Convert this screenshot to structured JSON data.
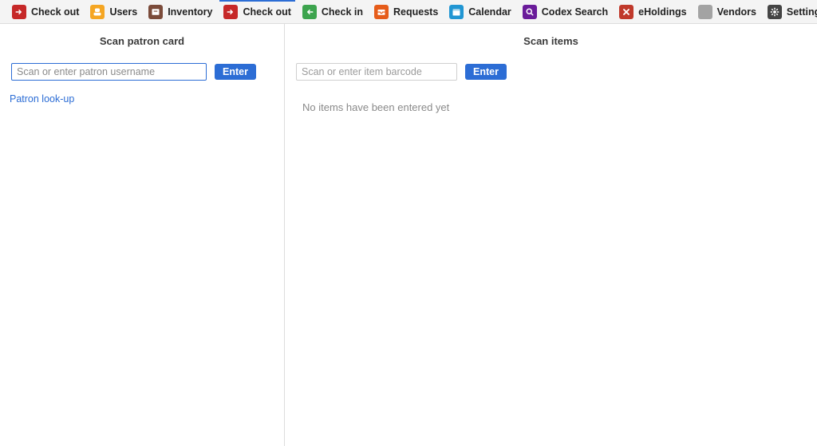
{
  "currentApp": {
    "label": "Check out"
  },
  "nav": {
    "items": [
      {
        "label": "Users",
        "color": "amber",
        "icon": "user"
      },
      {
        "label": "Inventory",
        "color": "brown",
        "icon": "drawer"
      },
      {
        "label": "Check out",
        "color": "red",
        "icon": "arrow-right",
        "active": true
      },
      {
        "label": "Check in",
        "color": "green",
        "icon": "arrow-left"
      },
      {
        "label": "Requests",
        "color": "orange",
        "icon": "inbox"
      },
      {
        "label": "Calendar",
        "color": "blue",
        "icon": "calendar"
      },
      {
        "label": "Codex Search",
        "color": "purple",
        "icon": "search"
      },
      {
        "label": "eHoldings",
        "color": "redx",
        "icon": "cross"
      },
      {
        "label": "Vendors",
        "color": "gray",
        "icon": "blank"
      },
      {
        "label": "Settings",
        "color": "dark",
        "icon": "gear"
      }
    ]
  },
  "patronPane": {
    "title": "Scan patron card",
    "input": {
      "placeholder": "Scan or enter patron username",
      "value": ""
    },
    "enterLabel": "Enter",
    "lookupLink": "Patron look-up"
  },
  "itemsPane": {
    "title": "Scan items",
    "input": {
      "placeholder": "Scan or enter item barcode",
      "value": ""
    },
    "enterLabel": "Enter",
    "emptyMessage": "No items have been entered yet"
  },
  "icons": {
    "user": "<rect x='4' y='2' width='8' height='6' rx='2' fill='white'/><rect x='2' y='9' width='12' height='5' rx='2' fill='white'/>",
    "drawer": "<rect x='2' y='3' width='12' height='10' rx='1' fill='white'/><rect x='5' y='6' width='6' height='1.5' fill='#7b4b3a'/>",
    "arrow-right": "<path d='M3 8h7M8 5l3 3-3 3' stroke='white' stroke-width='2' fill='none' stroke-linecap='round' stroke-linejoin='round'/>",
    "arrow-left": "<path d='M13 8H6M8 5L5 8l3 3' stroke='white' stroke-width='2' fill='none' stroke-linecap='round' stroke-linejoin='round'/>",
    "inbox": "<rect x='2' y='4' width='12' height='9' rx='1' fill='white'/><path d='M2 8h4l1 2h2l1-2h4' stroke='#e65c1a' stroke-width='1.5' fill='none'/>",
    "calendar": "<rect x='2' y='3' width='12' height='11' rx='1' fill='white'/><rect x='2' y='3' width='12' height='3' fill='#2196d3' opacity='0.4'/>",
    "search": "<circle cx='7' cy='7' r='4' stroke='white' stroke-width='2' fill='none'/><path d='M10 10l3 3' stroke='white' stroke-width='2' stroke-linecap='round'/>",
    "cross": "<path d='M4 4l8 8M12 4l-8 8' stroke='white' stroke-width='2.5' stroke-linecap='round'/>",
    "blank": "",
    "gear": "<circle cx='8' cy='8' r='2.5' fill='white'/><g stroke='white' stroke-width='2'><path d='M8 1v3M8 12v3M1 8h3M12 8h3M3 3l2 2M11 11l2 2M13 3l-2 2M5 11l-2 2'/></g>"
  }
}
